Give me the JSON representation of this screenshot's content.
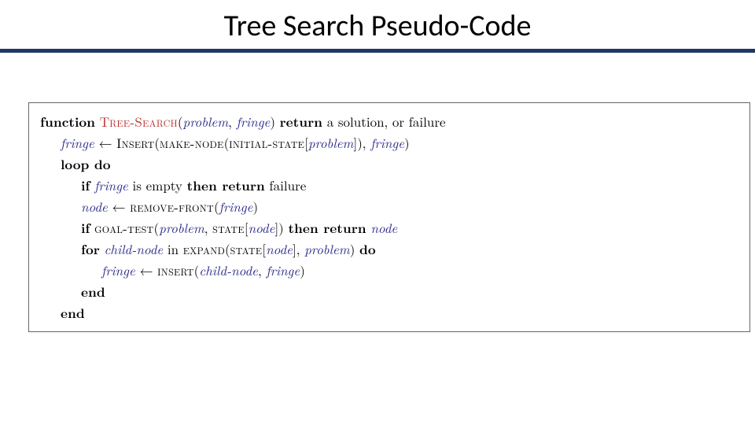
{
  "title": "Tree Search Pseudo-Code",
  "code": {
    "l1": {
      "kw1": "function",
      "fn": "Tree-Search",
      "op": "(",
      "a1": "problem",
      "c1": ", ",
      "a2": "fringe",
      "cp": ") ",
      "kw2": "return",
      "rest": " a solution, or failure"
    },
    "l2": {
      "a1": "fringe",
      "arr": " ← ",
      "sc1": "Insert",
      "op": "(",
      "sc2": "make-node",
      "op2": "(",
      "sc3": "initial-state",
      "br1": "[",
      "a2": "problem",
      "br2": "]), ",
      "a3": "fringe",
      "cp": ")"
    },
    "l3": {
      "kw": "loop do"
    },
    "l4": {
      "kw1": "if",
      "sp1": " ",
      "a1": "fringe",
      "mid": " is empty ",
      "kw2": "then return",
      "rest": " failure"
    },
    "l5": {
      "a1": "node",
      "arr": " ← ",
      "sc1": "remove-front",
      "op": "(",
      "a2": "fringe",
      "cp": ")"
    },
    "l6": {
      "kw1": "if",
      "sp1": " ",
      "sc1": "goal-test",
      "op": "(",
      "a1": "problem",
      "c1": ", ",
      "sc2": "state",
      "br1": "[",
      "a2": "node",
      "br2": "]) ",
      "kw2": "then return",
      "sp2": " ",
      "a3": "node"
    },
    "l7": {
      "kw1": "for",
      "sp1": " ",
      "a1": "child-node",
      "mid": " in ",
      "sc1": "expand",
      "op": "(",
      "sc2": "state",
      "br1": "[",
      "a2": "node",
      "br2": "], ",
      "a3": "problem",
      "cp": ") ",
      "kw2": "do"
    },
    "l8": {
      "a1": "fringe",
      "arr": " ← ",
      "sc1": "insert",
      "op": "(",
      "a2": "child-node",
      "c1": ", ",
      "a3": "fringe",
      "cp": ")"
    },
    "l9": {
      "kw": "end"
    },
    "l10": {
      "kw": "end"
    }
  }
}
